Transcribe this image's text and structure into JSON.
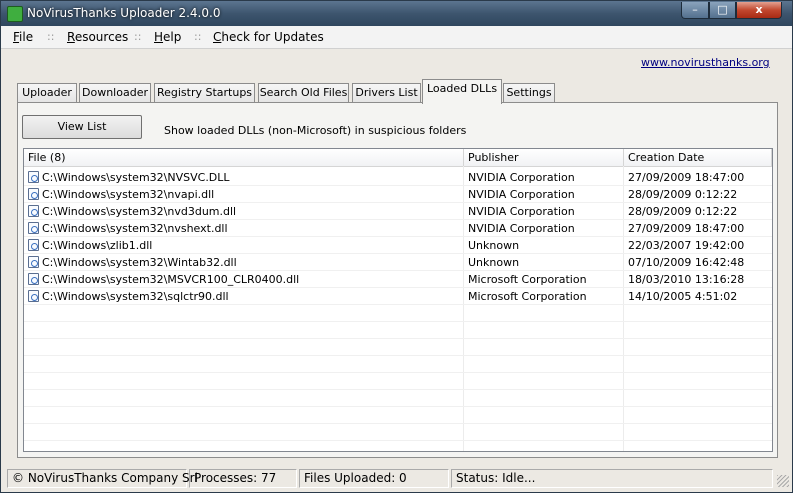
{
  "window": {
    "title": "NoVirusThanks Uploader 2.4.0.0",
    "buttons": {
      "minimize": "–",
      "maximize": "□",
      "close": "x"
    }
  },
  "menu": {
    "items": [
      {
        "prefix": "",
        "underline": "F",
        "rest": "ile"
      },
      {
        "prefix": "",
        "underline": "R",
        "rest": "esources"
      },
      {
        "prefix": "",
        "underline": "H",
        "rest": "elp"
      },
      {
        "prefix": "",
        "underline": "C",
        "rest": "heck for Updates"
      }
    ],
    "separator": "::"
  },
  "site_link": "www.novirusthanks.org",
  "tabs": [
    {
      "label": "Uploader",
      "active": false
    },
    {
      "label": "Downloader",
      "active": false
    },
    {
      "label": "Registry Startups",
      "active": false
    },
    {
      "label": "Search Old Files",
      "active": false
    },
    {
      "label": "Drivers List",
      "active": false
    },
    {
      "label": "Loaded DLLs",
      "active": true
    },
    {
      "label": "Settings",
      "active": false
    }
  ],
  "toolbar": {
    "view_button": "View List",
    "description": "Show loaded DLLs (non-Microsoft) in suspicious folders"
  },
  "table": {
    "columns": [
      "File (8)",
      "Publisher",
      "Creation Date"
    ],
    "rows": [
      {
        "file": "C:\\Windows\\system32\\NVSVC.DLL",
        "publisher": "NVIDIA Corporation",
        "date": "27/09/2009 18:47:00"
      },
      {
        "file": "C:\\Windows\\system32\\nvapi.dll",
        "publisher": "NVIDIA Corporation",
        "date": "28/09/2009 0:12:22"
      },
      {
        "file": "C:\\Windows\\system32\\nvd3dum.dll",
        "publisher": "NVIDIA Corporation",
        "date": "28/09/2009 0:12:22"
      },
      {
        "file": "C:\\Windows\\system32\\nvshext.dll",
        "publisher": "NVIDIA Corporation",
        "date": "27/09/2009 18:47:00"
      },
      {
        "file": "C:\\Windows\\zlib1.dll",
        "publisher": "Unknown",
        "date": "22/03/2007 19:42:00"
      },
      {
        "file": "C:\\Windows\\system32\\Wintab32.dll",
        "publisher": "Unknown",
        "date": "07/10/2009 16:42:48"
      },
      {
        "file": "C:\\Windows\\system32\\MSVCR100_CLR0400.dll",
        "publisher": "Microsoft Corporation",
        "date": "18/03/2010 13:16:28"
      },
      {
        "file": "C:\\Windows\\system32\\sqlctr90.dll",
        "publisher": "Microsoft Corporation",
        "date": "14/10/2005 4:51:02"
      }
    ]
  },
  "status": {
    "company": "© NoVirusThanks Company Srl",
    "processes": "Processes:  77",
    "files_uploaded": "Files Uploaded:  0",
    "state": "Status: Idle..."
  }
}
